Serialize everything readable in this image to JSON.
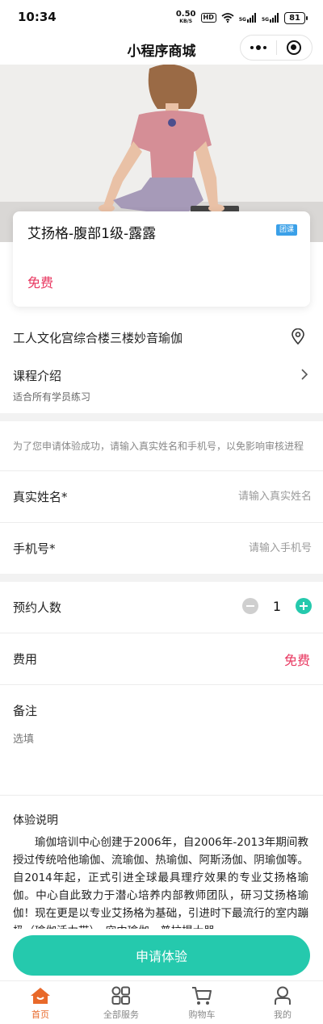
{
  "status_bar": {
    "time": "10:34",
    "net_speed_value": "0.50",
    "net_speed_unit": "KB/S",
    "hd_label": "HD",
    "signal_label_1": "5G",
    "signal_label_2": "5G",
    "battery": "81"
  },
  "nav": {
    "title": "小程序商城"
  },
  "course": {
    "title": "艾扬格-腹部1级-露露",
    "tag": "团课",
    "price": "免费"
  },
  "location": {
    "text": "工人文化宫综合楼三楼妙音瑜伽"
  },
  "intro": {
    "title": "课程介绍",
    "subtitle": "适合所有学员练习"
  },
  "form": {
    "tip": "为了您申请体验成功，请输入真实姓名和手机号，以免影响审核进程",
    "name_label": "真实姓名*",
    "name_placeholder": "请输入真实姓名",
    "phone_label": "手机号*",
    "phone_placeholder": "请输入手机号"
  },
  "booking": {
    "count_label": "预约人数",
    "count_value": "1",
    "fee_label": "费用",
    "fee_value": "免费",
    "remark_label": "备注",
    "remark_placeholder": "选填"
  },
  "experience": {
    "title": "体验说明",
    "body": "瑜伽培训中心创建于2006年，自2006年-2013年期间教授过传统哈他瑜伽、流瑜伽、热瑜伽、阿斯汤伽、阴瑜伽等。自2014年起，正式引进全球最具理疗效果的专业艾扬格瑜伽。中心自此致力于潜心培养内部教师团队，研习艾扬格瑜伽！现在更是以专业艾扬格为基础，引进时下最流行的室内蹦极（瑜伽活力带）、空中瑜伽、普拉提大器"
  },
  "actions": {
    "apply_label": "申请体验"
  },
  "tab_bar": {
    "items": [
      {
        "label": "首页",
        "icon": "home-icon",
        "active": true
      },
      {
        "label": "全部服务",
        "icon": "grid-icon",
        "active": false
      },
      {
        "label": "购物车",
        "icon": "cart-icon",
        "active": false
      },
      {
        "label": "我的",
        "icon": "user-icon",
        "active": false
      }
    ]
  },
  "colors": {
    "accent": "#25c9ad",
    "price": "#e8365f",
    "tab_active": "#e8692a",
    "tag": "#3aa0e8"
  }
}
